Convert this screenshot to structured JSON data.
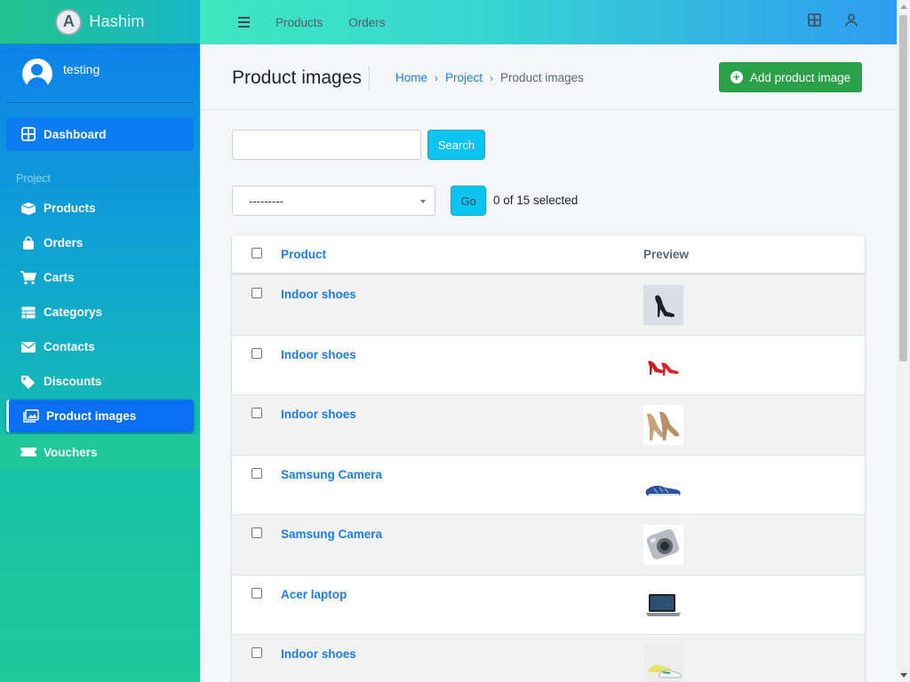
{
  "brand": {
    "name": "Hashim",
    "logo_letter": "A"
  },
  "user": {
    "name": "testing"
  },
  "sidebar": {
    "dashboard": "Dashboard",
    "section_header": "Project",
    "items": [
      {
        "label": "Products",
        "icon": "box-icon"
      },
      {
        "label": "Orders",
        "icon": "bag-icon"
      },
      {
        "label": "Carts",
        "icon": "cart-icon"
      },
      {
        "label": "Categorys",
        "icon": "table-icon"
      },
      {
        "label": "Contacts",
        "icon": "envelope-icon"
      },
      {
        "label": "Discounts",
        "icon": "tags-icon"
      },
      {
        "label": "Product images",
        "icon": "images-icon",
        "active": true
      },
      {
        "label": "Vouchers",
        "icon": "ticket-icon"
      }
    ]
  },
  "topbar": {
    "links": [
      "Products",
      "Orders"
    ]
  },
  "header": {
    "title": "Product images",
    "breadcrumb": [
      "Home",
      "Project",
      "Product images"
    ],
    "add_button": "Add product image"
  },
  "search": {
    "value": "",
    "button": "Search"
  },
  "actions": {
    "select_value": "---------",
    "go_button": "Go",
    "selected_text": "0 of 15 selected"
  },
  "table": {
    "columns": [
      "Product",
      "Preview"
    ],
    "rows": [
      {
        "product": "Indoor shoes",
        "preview": "black high heel"
      },
      {
        "product": "Indoor shoes",
        "preview": "red high heels"
      },
      {
        "product": "Indoor shoes",
        "preview": "beige high heels"
      },
      {
        "product": "Samsung Camera",
        "preview": "running shoe"
      },
      {
        "product": "Samsung Camera",
        "preview": "silver camera"
      },
      {
        "product": "Acer laptop",
        "preview": "laptop"
      },
      {
        "product": "Indoor shoes",
        "preview": "sneakers"
      }
    ]
  },
  "colors": {
    "primary": "#1a7ef0",
    "success": "#2aa148",
    "info": "#0dc4f0"
  }
}
